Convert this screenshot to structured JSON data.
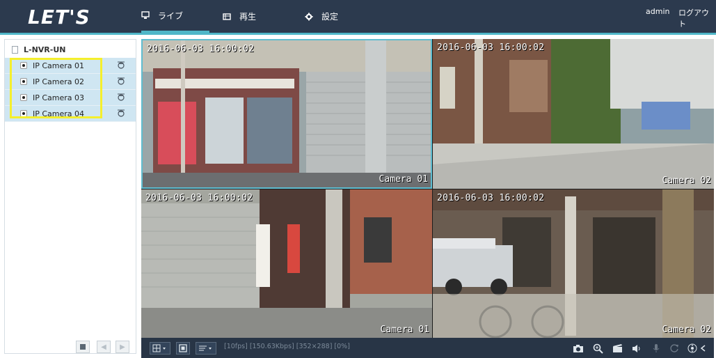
{
  "header": {
    "logo": "LET'S",
    "nav": [
      {
        "label": "ライブ",
        "icon": "monitor-icon",
        "active": true
      },
      {
        "label": "再生",
        "icon": "playback-icon",
        "active": false
      },
      {
        "label": "設定",
        "icon": "gear-icon",
        "active": false
      }
    ],
    "user": "admin",
    "logout": "ログアウト"
  },
  "sidebar": {
    "device": "L-NVR-UN",
    "cameras": [
      {
        "label": "IP Camera 01"
      },
      {
        "label": "IP Camera 02"
      },
      {
        "label": "IP Camera 03"
      },
      {
        "label": "IP Camera 04"
      }
    ]
  },
  "video": {
    "tiles": [
      {
        "timestamp": "2016-06-03 16:00:02",
        "name": "Camera 01"
      },
      {
        "timestamp": "2016-06-03 16:00:02",
        "name": "Camera 02"
      },
      {
        "timestamp": "2016-06-03 16:00:02",
        "name": "Camera 01"
      },
      {
        "timestamp": "2016-06-03 16:00:02",
        "name": "Camera 02"
      }
    ]
  },
  "toolbar": {
    "status": "[10fps] [150.63Kbps] [352×288] [0%]"
  },
  "colors": {
    "header_bg": "#2c3a4e",
    "accent": "#4fb7c8",
    "camera_highlight": "#f5ef2c",
    "camera_row_bg": "#cfe6f2",
    "toolbar_bg": "#283546"
  }
}
